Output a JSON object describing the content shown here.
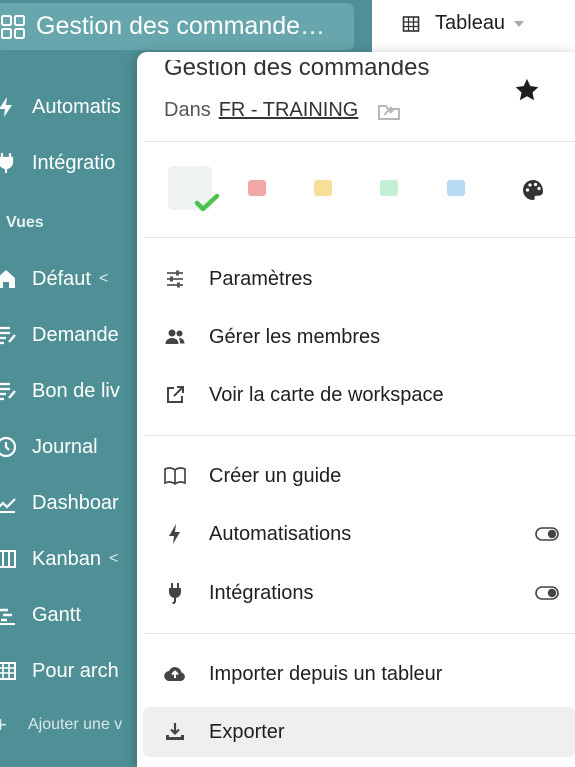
{
  "sidebar": {
    "title": "Gestion des commande…",
    "items": [
      {
        "label": "Automatis",
        "icon": "bolt-icon"
      },
      {
        "label": "Intégratio",
        "icon": "plug-icon"
      }
    ],
    "section_label": "Vues",
    "views": [
      {
        "label": "Défaut",
        "icon": "home-icon"
      },
      {
        "label": "Demande",
        "icon": "form-icon"
      },
      {
        "label": "Bon de liv",
        "icon": "form-icon"
      },
      {
        "label": "Journal",
        "icon": "clock-icon"
      },
      {
        "label": "Dashboar",
        "icon": "chart-icon"
      },
      {
        "label": "Kanban",
        "icon": "kanban-icon"
      },
      {
        "label": "Gantt",
        "icon": "gantt-icon"
      },
      {
        "label": "Pour arch",
        "icon": "table-icon"
      }
    ],
    "add_view_label": "Ajouter une v"
  },
  "view_selector": {
    "label": "Tableau",
    "icon": "table-icon"
  },
  "popup": {
    "title": "Gestion des commandes",
    "location_prefix": "Dans",
    "workspace_name": "FR - TRAINING",
    "colors": [
      "#eef2f1",
      "#f2a6a6",
      "#f8df99",
      "#c3f0d4",
      "#b7d9f2"
    ],
    "selected_color_index": 0,
    "menu_groups": [
      [
        {
          "label": "Paramètres",
          "icon": "sliders-icon"
        },
        {
          "label": "Gérer les membres",
          "icon": "users-icon"
        },
        {
          "label": "Voir la carte de workspace",
          "icon": "external-link-icon"
        }
      ],
      [
        {
          "label": "Créer un guide",
          "icon": "book-icon"
        },
        {
          "label": "Automatisations",
          "icon": "bolt-icon",
          "toggle": true
        },
        {
          "label": "Intégrations",
          "icon": "plug-icon",
          "toggle": true
        }
      ],
      [
        {
          "label": "Importer depuis un tableur",
          "icon": "cloud-upload-icon"
        },
        {
          "label": "Exporter",
          "icon": "download-icon",
          "active": true
        }
      ]
    ]
  },
  "theme": {
    "sidebar_bg": "#4f9097",
    "title_bg": "#67a6ac",
    "check_color": "#4cc24a"
  }
}
